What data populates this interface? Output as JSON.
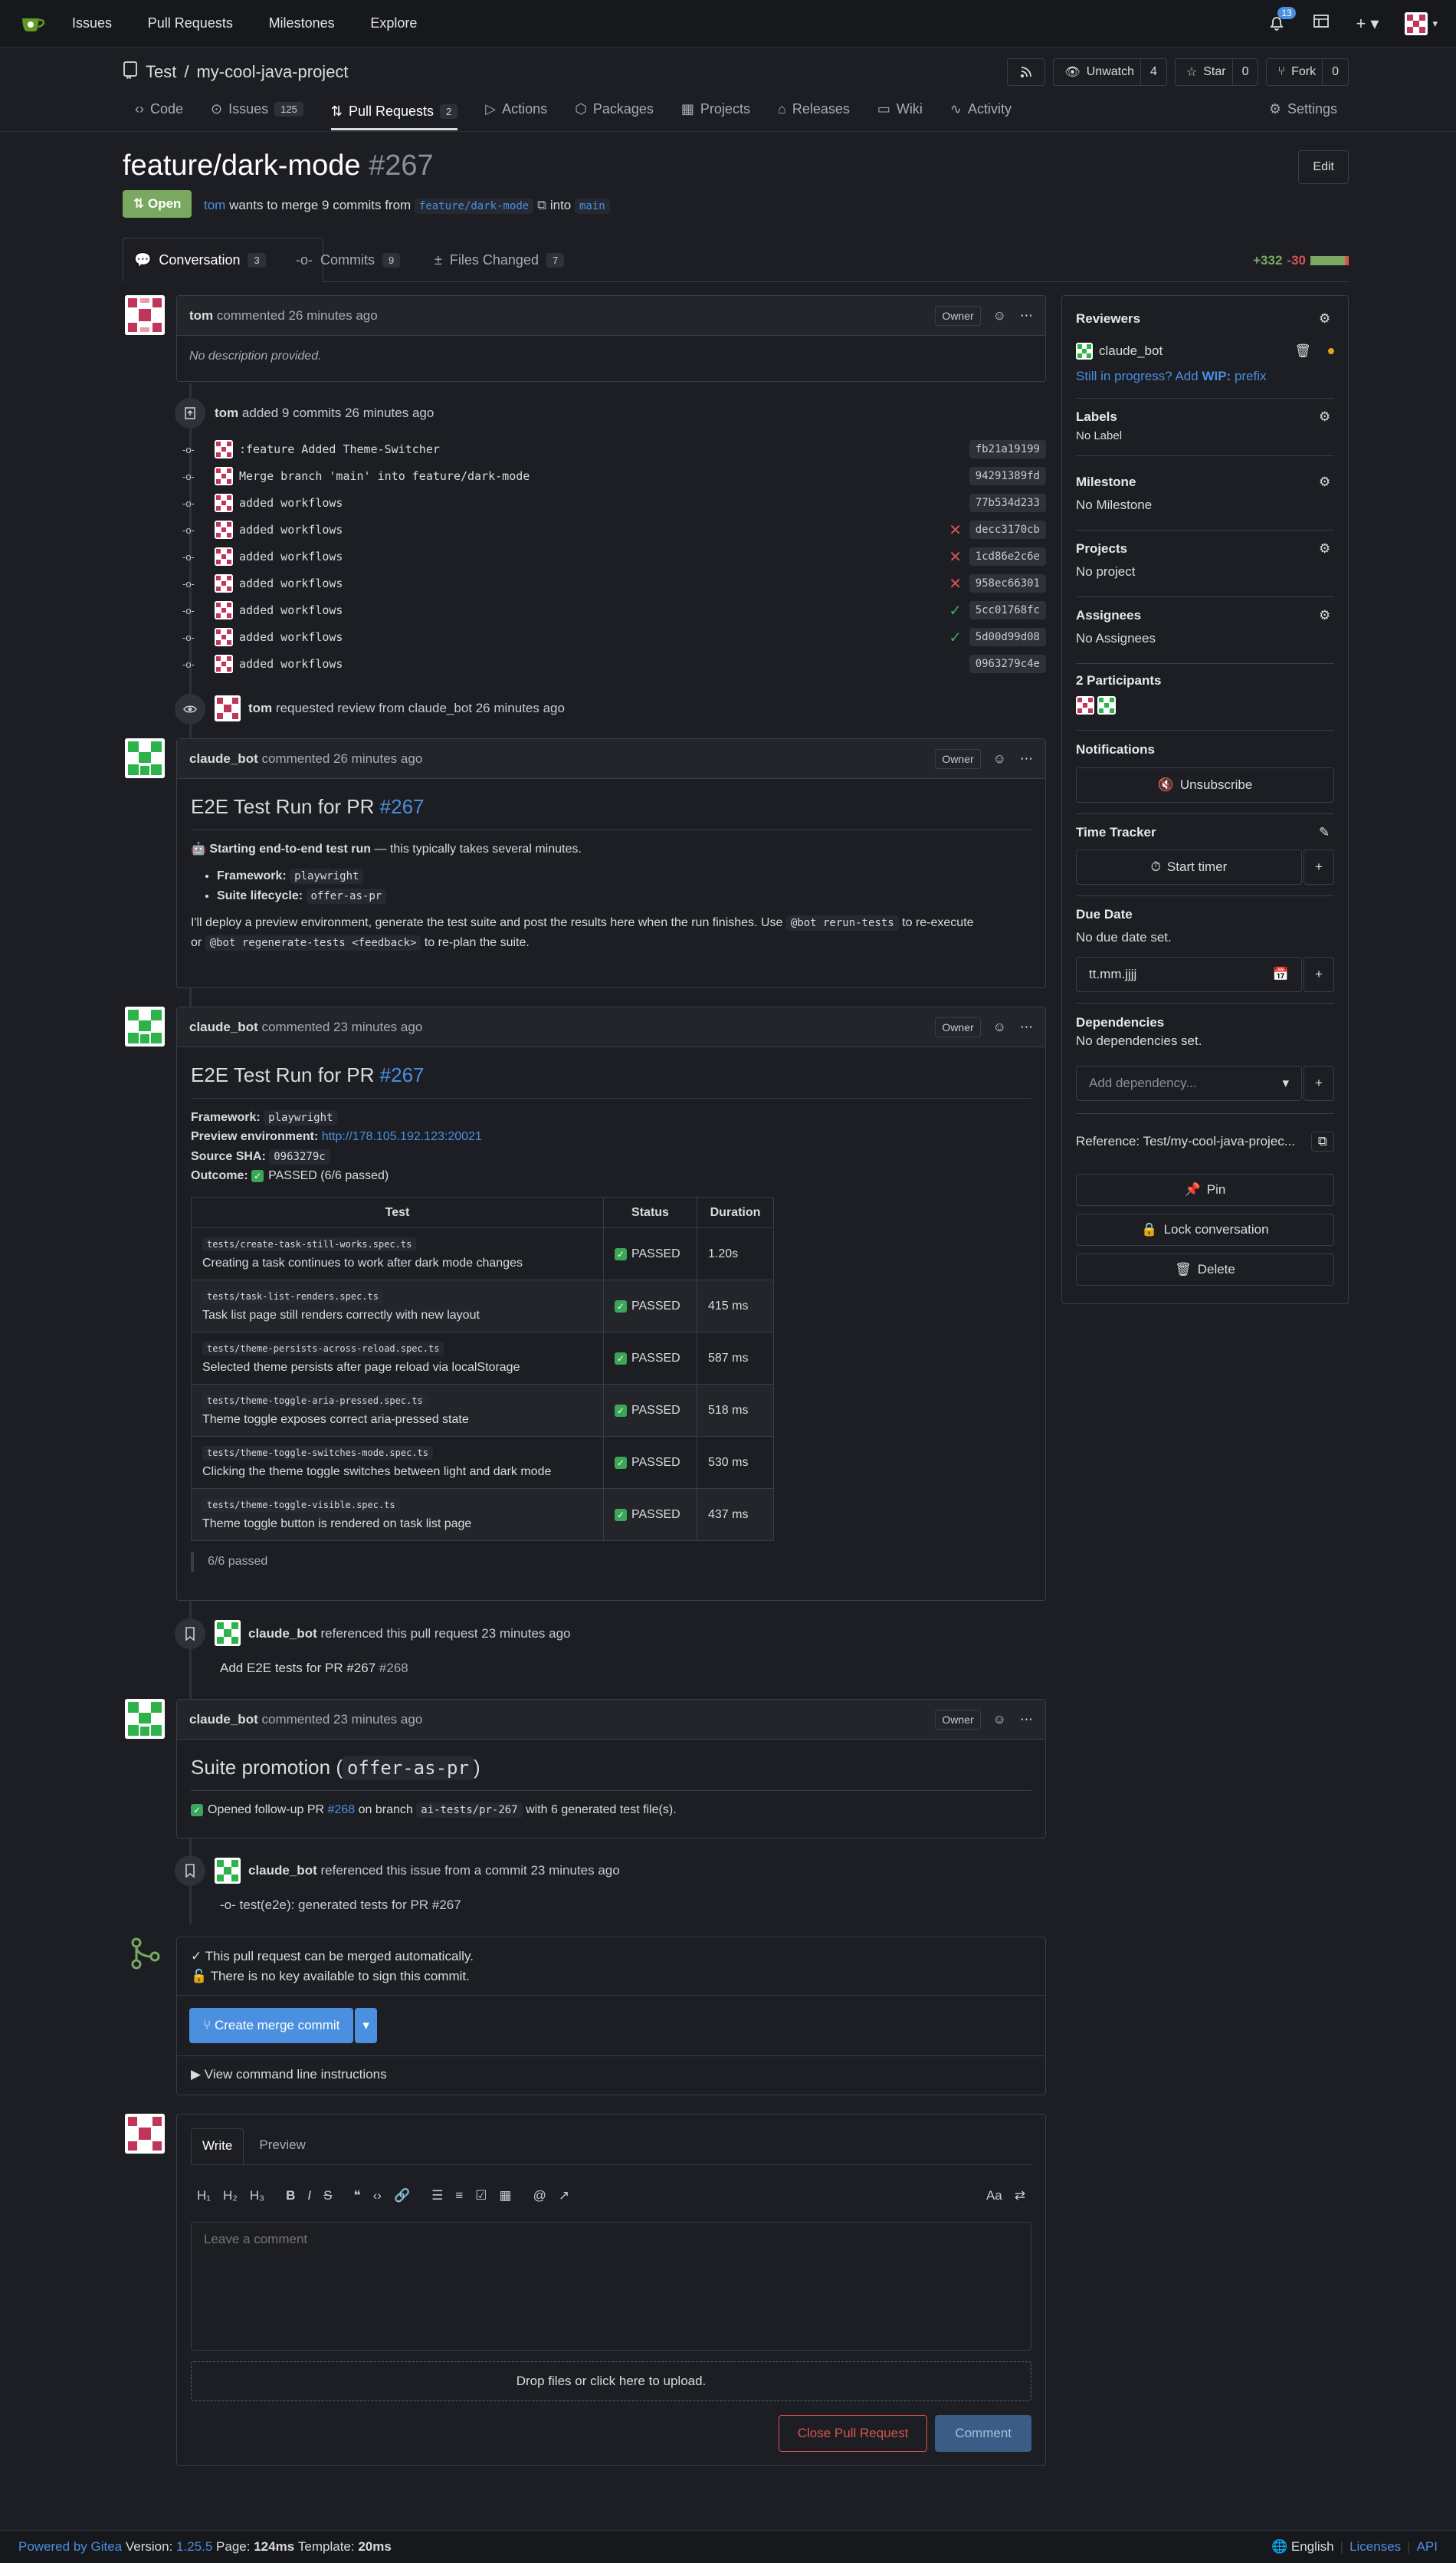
{
  "topnav": {
    "items": [
      "Issues",
      "Pull Requests",
      "Milestones",
      "Explore"
    ],
    "notification_count": "13"
  },
  "repo": {
    "owner": "Test",
    "name": "my-cool-java-project",
    "unwatch_label": "Unwatch",
    "watch_count": "4",
    "star_label": "Star",
    "star_count": "0",
    "fork_label": "Fork",
    "fork_count": "0",
    "tabs": [
      {
        "label": "Code"
      },
      {
        "label": "Issues",
        "count": "125"
      },
      {
        "label": "Pull Requests",
        "count": "2"
      },
      {
        "label": "Actions"
      },
      {
        "label": "Packages"
      },
      {
        "label": "Projects"
      },
      {
        "label": "Releases"
      },
      {
        "label": "Wiki"
      },
      {
        "label": "Activity"
      }
    ],
    "settings_label": "Settings"
  },
  "pr": {
    "title": "feature/dark-mode",
    "number": "#267",
    "edit_label": "Edit",
    "status": "Open",
    "author": "tom",
    "summary_mid": "wants to merge 9 commits from",
    "head_branch": "feature/dark-mode",
    "into_text": "into",
    "base_branch": "main",
    "tabs": [
      {
        "label": "Conversation",
        "count": "3"
      },
      {
        "label": "Commits",
        "count": "9"
      },
      {
        "label": "Files Changed",
        "count": "7"
      }
    ],
    "additions": "+332",
    "deletions": "-30"
  },
  "comment1": {
    "author": "tom",
    "meta": "commented 26 minutes ago",
    "owner": "Owner",
    "body": "No description provided."
  },
  "commits_event": {
    "author": "tom",
    "text": "added 9 commits 26 minutes ago",
    "commits": [
      {
        "msg": ":feature Added Theme-Switcher",
        "sha": "fb21a19199",
        "status": ""
      },
      {
        "msg": "Merge branch 'main' into feature/dark-mode",
        "sha": "94291389fd",
        "status": ""
      },
      {
        "msg": "added workflows",
        "sha": "77b534d233",
        "status": ""
      },
      {
        "msg": "added workflows",
        "sha": "decc3170cb",
        "status": "fail"
      },
      {
        "msg": "added workflows",
        "sha": "1cd86e2c6e",
        "status": "fail"
      },
      {
        "msg": "added workflows",
        "sha": "958ec66301",
        "status": "fail"
      },
      {
        "msg": "added workflows",
        "sha": "5cc01768fc",
        "status": "pass"
      },
      {
        "msg": "added workflows",
        "sha": "5d00d99d08",
        "status": "pass"
      },
      {
        "msg": "added workflows",
        "sha": "0963279c4e",
        "status": ""
      }
    ]
  },
  "review_event": {
    "author": "tom",
    "text": "requested review from claude_bot 26 minutes ago"
  },
  "comment2": {
    "author": "claude_bot",
    "meta": "commented 26 minutes ago",
    "owner": "Owner",
    "heading": "E2E Test Run for PR",
    "heading_link": "#267",
    "lead_bold": "Starting end-to-end test run",
    "lead_rest": " — this typically takes several minutes.",
    "li1_label": "Framework:",
    "li1_value": "playwright",
    "li2_label": "Suite lifecycle:",
    "li2_value": "offer-as-pr",
    "p1": "I'll deploy a preview environment, generate the test suite and post the results here when the run finishes. Use",
    "code1": "@bot rerun-tests",
    "p2": "to re-execute",
    "p3": "or",
    "code2": "@bot regenerate-tests <feedback>",
    "p4": "to re-plan the suite."
  },
  "comment3": {
    "author": "claude_bot",
    "meta": "commented 23 minutes ago",
    "owner": "Owner",
    "heading": "E2E Test Run for PR",
    "heading_link": "#267",
    "framework_label": "Framework:",
    "framework_value": "playwright",
    "preview_label": "Preview environment:",
    "preview_value": "http://178.105.192.123:20021",
    "sha_label": "Source SHA:",
    "sha_value": "0963279c",
    "outcome_label": "Outcome:",
    "outcome_value": "PASSED (6/6 passed)",
    "table_headers": [
      "Test",
      "Status",
      "Duration"
    ],
    "rows": [
      {
        "file": "tests/create-task-still-works.spec.ts",
        "desc": "Creating a task continues to work after dark mode changes",
        "status": "PASSED",
        "duration": "1.20s"
      },
      {
        "file": "tests/task-list-renders.spec.ts",
        "desc": "Task list page still renders correctly with new layout",
        "status": "PASSED",
        "duration": "415 ms"
      },
      {
        "file": "tests/theme-persists-across-reload.spec.ts",
        "desc": "Selected theme persists after page reload via localStorage",
        "status": "PASSED",
        "duration": "587 ms"
      },
      {
        "file": "tests/theme-toggle-aria-pressed.spec.ts",
        "desc": "Theme toggle exposes correct aria-pressed state",
        "status": "PASSED",
        "duration": "518 ms"
      },
      {
        "file": "tests/theme-toggle-switches-mode.spec.ts",
        "desc": "Clicking the theme toggle switches between light and dark mode",
        "status": "PASSED",
        "duration": "530 ms"
      },
      {
        "file": "tests/theme-toggle-visible.spec.ts",
        "desc": "Theme toggle button is rendered on task list page",
        "status": "PASSED",
        "duration": "437 ms"
      }
    ],
    "quote": "6/6 passed"
  },
  "ref_event1": {
    "author": "claude_bot",
    "text": "referenced this pull request 23 minutes ago",
    "ref_title": "Add E2E tests for PR #267",
    "ref_num": "#268"
  },
  "comment4": {
    "author": "claude_bot",
    "meta": "commented 23 minutes ago",
    "owner": "Owner",
    "heading_pre": "Suite promotion (",
    "heading_code": "offer-as-pr",
    "heading_post": ")",
    "p_pre": "Opened follow-up PR",
    "p_link": "#268",
    "p_mid": "on branch",
    "p_code": "ai-tests/pr-267",
    "p_post": "with 6 generated test file(s)."
  },
  "ref_event2": {
    "author": "claude_bot",
    "text": "referenced this issue from a commit 23 minutes ago",
    "commit_text": "test(e2e): generated tests for PR #267"
  },
  "merge": {
    "line1": "This pull request can be merged automatically.",
    "line2": "There is no key available to sign this commit.",
    "button": "Create merge commit",
    "cli": "View command line instructions"
  },
  "editor": {
    "tab_write": "Write",
    "tab_preview": "Preview",
    "placeholder": "Leave a comment",
    "drop": "Drop files or click here to upload.",
    "close_btn": "Close Pull Request",
    "comment_btn": "Comment"
  },
  "sidebar": {
    "reviewers_h": "Reviewers",
    "reviewer": "claude_bot",
    "wip_pre": "Still in progress? Add",
    "wip_bold": "WIP:",
    "wip_post": "prefix",
    "labels_h": "Labels",
    "labels_v": "No Label",
    "milestone_h": "Milestone",
    "milestone_v": "No Milestone",
    "projects_h": "Projects",
    "projects_v": "No project",
    "assignees_h": "Assignees",
    "assignees_v": "No Assignees",
    "participants_h": "2 Participants",
    "notifications_h": "Notifications",
    "unsubscribe": "Unsubscribe",
    "time_h": "Time Tracker",
    "start_timer": "Start timer",
    "due_h": "Due Date",
    "due_v": "No due date set.",
    "date_placeholder": "tt.mm.jjjj",
    "deps_h": "Dependencies",
    "deps_v": "No dependencies set.",
    "add_dep": "Add dependency...",
    "reference": "Reference: Test/my-cool-java-projec...",
    "pin": "Pin",
    "lock": "Lock conversation",
    "delete": "Delete"
  },
  "footer": {
    "powered": "Powered by Gitea",
    "version_label": "Version:",
    "version": "1.25.5",
    "page_label": "Page:",
    "page_time": "124ms",
    "template_label": "Template:",
    "template_time": "20ms",
    "language": "English",
    "licenses": "Licenses",
    "api": "API"
  },
  "colors": {
    "accent": "#4a8fe0",
    "open": "#79a860",
    "pass": "#3aa657",
    "fail": "#d9534f",
    "add": "#79a860",
    "del": "#d9534f"
  }
}
